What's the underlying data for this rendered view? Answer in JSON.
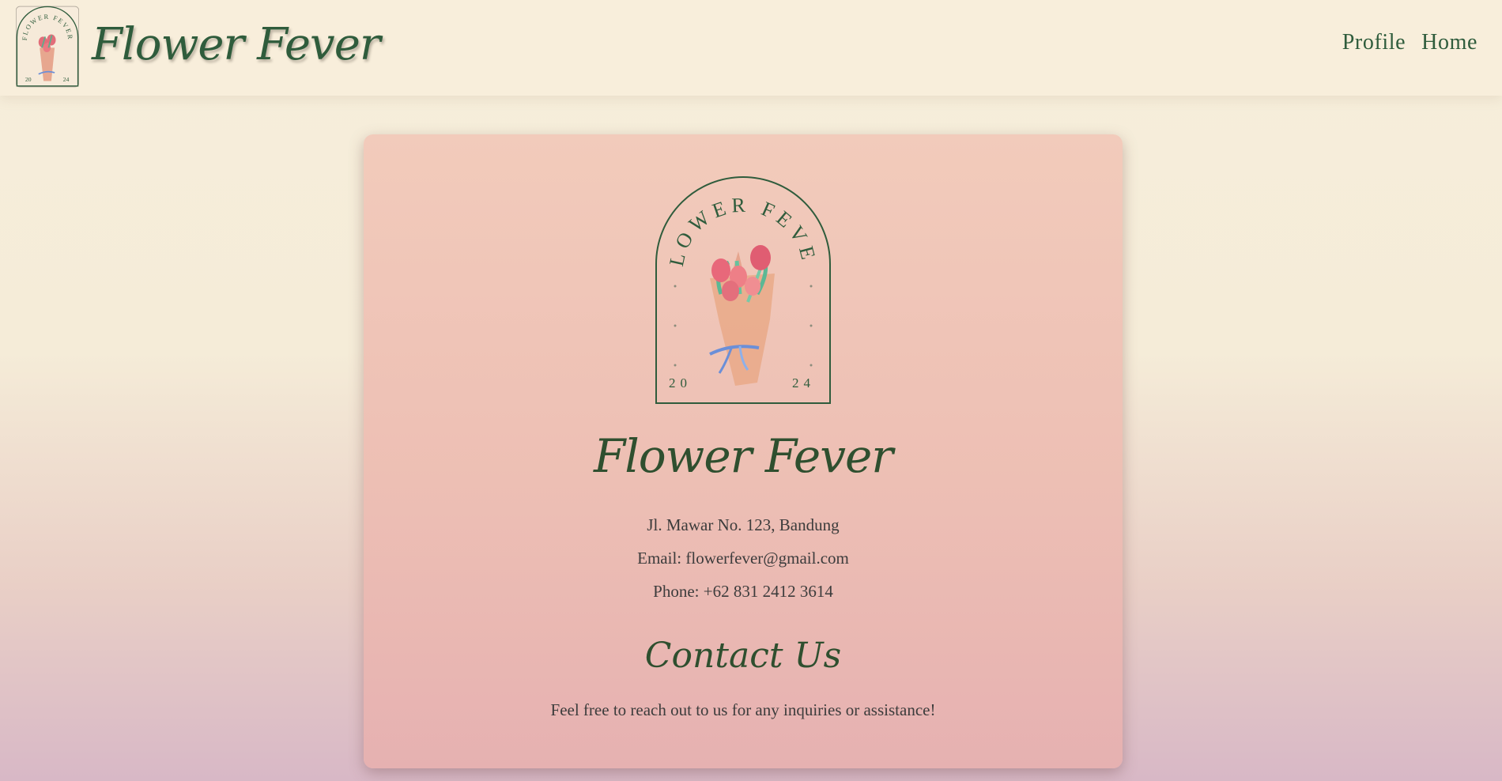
{
  "header": {
    "title": "Flower Fever",
    "logo": {
      "arc_text": "FLOWER FEVER",
      "year_left": "20",
      "year_right": "24",
      "icon": "flower-bouquet-icon"
    },
    "nav": [
      {
        "label": "Profile"
      },
      {
        "label": "Home"
      }
    ]
  },
  "card": {
    "logo": {
      "arc_text": "FLOWER FEVER",
      "year_left": "20",
      "year_right": "24",
      "icon": "flower-bouquet-icon"
    },
    "title": "Flower Fever",
    "address": "Jl. Mawar No. 123, Bandung",
    "email": "Email: flowerfever@gmail.com",
    "phone": "Phone: +62 831 2412 3614",
    "contact_title": "Contact Us",
    "contact_text": "Feel free to reach out to us for any inquiries or assistance!"
  },
  "colors": {
    "accent_green": "#2f5c3c",
    "header_bg": "#f8eedb",
    "card_top": "#f2cbbb",
    "card_bottom": "#e6b1b1"
  }
}
